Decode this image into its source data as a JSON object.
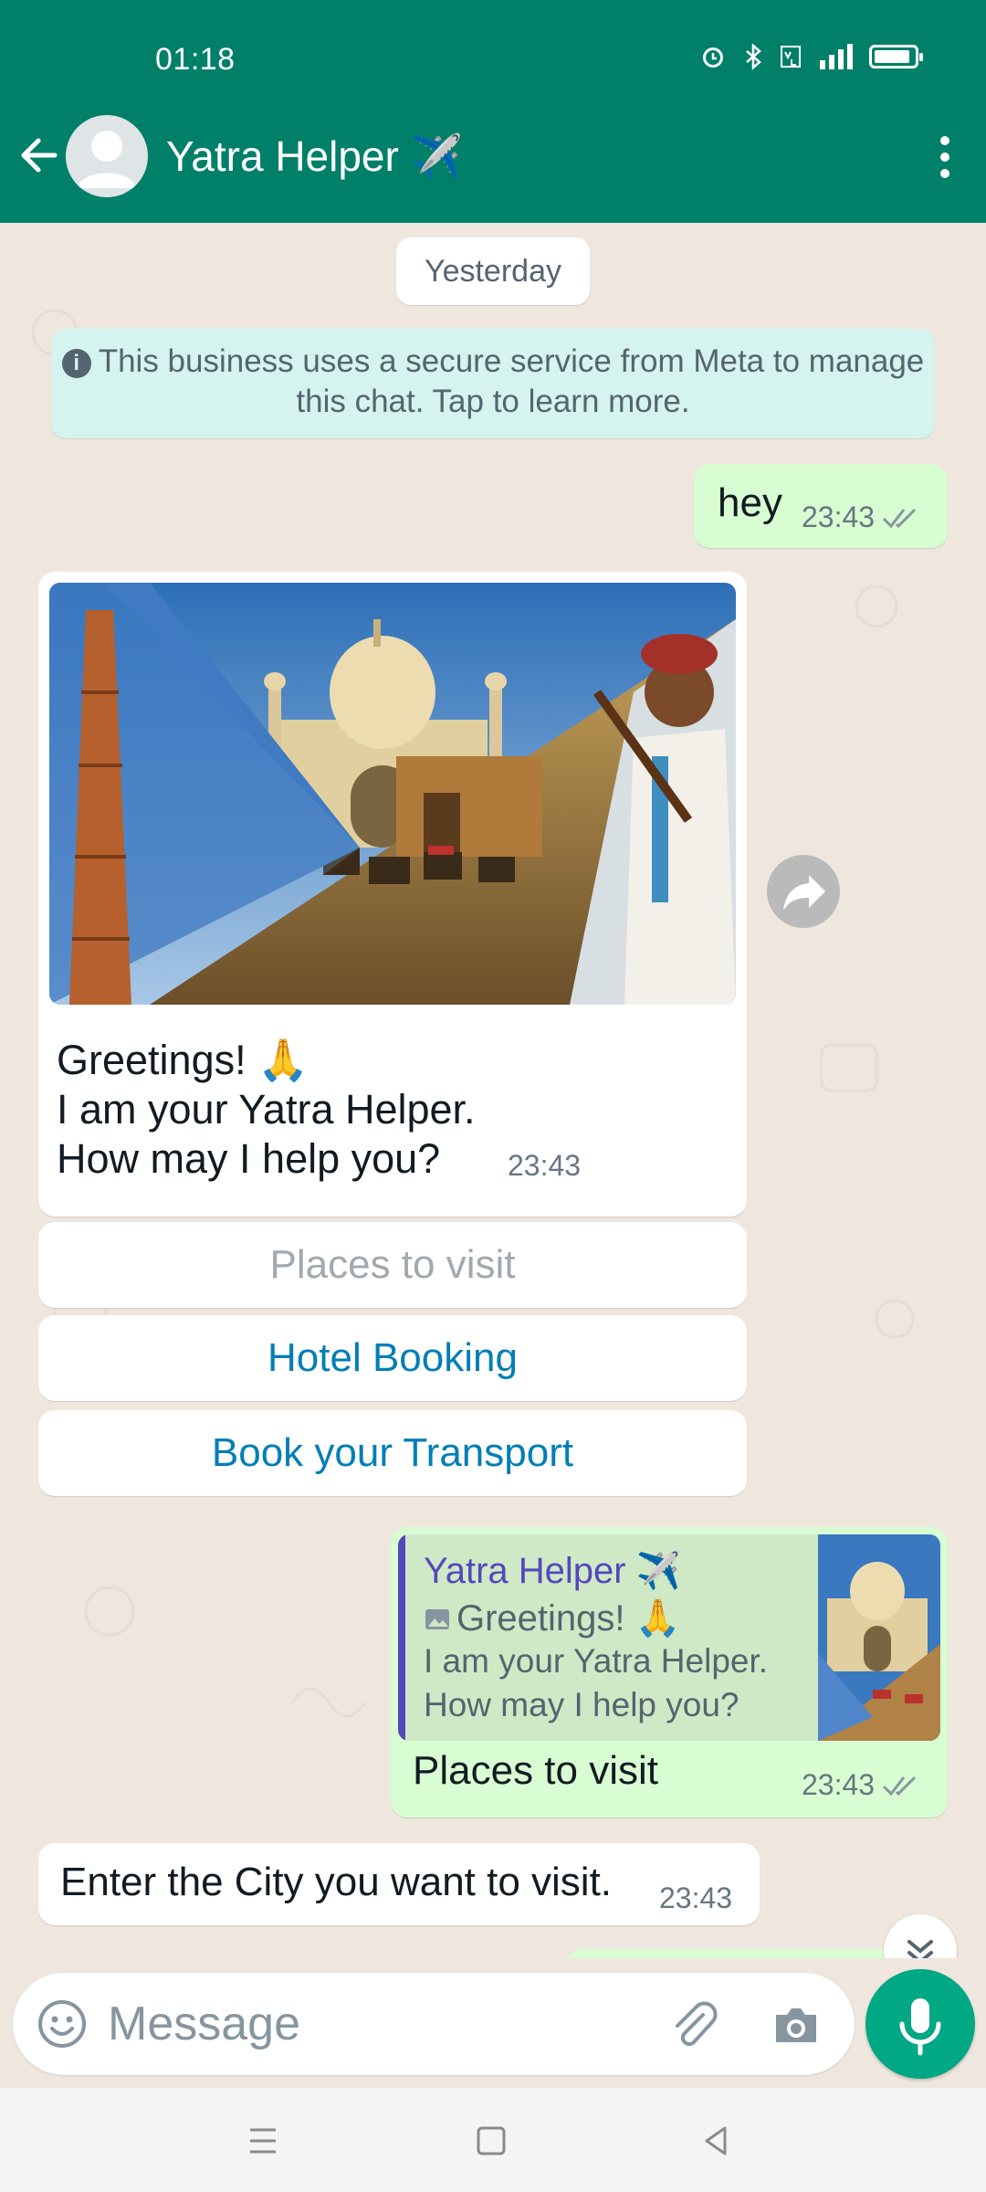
{
  "status_bar": {
    "time": "01:18"
  },
  "header": {
    "title": "Yatra Helper ✈️",
    "colors": {
      "primary": "#008069"
    }
  },
  "chat": {
    "date_separator": "Yesterday",
    "notice": "This business uses a secure service from Meta to manage this chat. Tap to learn more.",
    "messages": [
      {
        "direction": "out",
        "text": "hey",
        "time": "23:43",
        "status": "read"
      },
      {
        "direction": "in",
        "image": "india-landmarks-collage",
        "lines": [
          "Greetings! 🙏",
          "I am your Yatra Helper.",
          "How may I help you?"
        ],
        "time": "23:43",
        "quick_replies": [
          "Places to visit",
          "Hotel Booking",
          "Book your Transport"
        ]
      },
      {
        "direction": "out",
        "quote": {
          "author": "Yatra Helper ✈️",
          "line1": "Greetings! 🙏",
          "line2": "I am your Yatra Helper.",
          "line3": "How may I help you?"
        },
        "text": "Places to visit",
        "time": "23:43",
        "status": "read"
      },
      {
        "direction": "in",
        "text": "Enter the City you want to visit.",
        "time": "23:43"
      }
    ]
  },
  "composer": {
    "placeholder": "Message"
  },
  "icons": [
    "back-arrow-icon",
    "avatar-icon",
    "more-vert-icon",
    "info-icon",
    "forward-icon",
    "double-check-icon",
    "chevron-down-icon",
    "emoji-icon",
    "attach-icon",
    "camera-icon",
    "mic-icon",
    "recent-apps-icon",
    "home-icon",
    "nav-back-icon"
  ]
}
